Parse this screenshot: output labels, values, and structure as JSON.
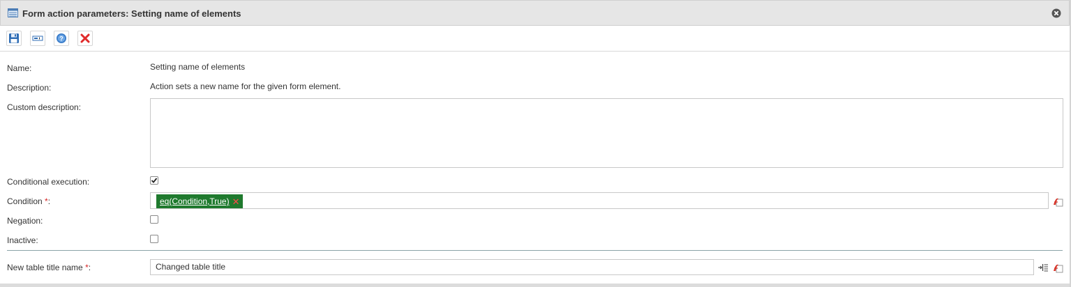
{
  "window": {
    "title": "Form action parameters: Setting name of elements",
    "title_icon": "form-table-icon",
    "close_icon": "close-circle-icon"
  },
  "toolbar": {
    "buttons": [
      {
        "name": "save-button",
        "icon": "floppy-disk-icon"
      },
      {
        "name": "text-field-button",
        "icon": "text-field-icon"
      },
      {
        "name": "help-button",
        "icon": "question-circle-icon"
      },
      {
        "name": "cancel-button",
        "icon": "red-x-icon"
      }
    ]
  },
  "form": {
    "name": {
      "label": "Name:",
      "value": "Setting name of elements"
    },
    "description": {
      "label": "Description:",
      "value": "Action sets a new name for the given form element."
    },
    "custom_description": {
      "label": "Custom description:",
      "value": ""
    },
    "conditional_execution": {
      "label": "Conditional execution:",
      "checked": true
    },
    "condition": {
      "label": "Condition",
      "required_mark": "*",
      "colon": ":",
      "token": "eq(Condition,True)",
      "token_remove": "✕"
    },
    "negation": {
      "label": "Negation:",
      "checked": false
    },
    "inactive": {
      "label": "Inactive:",
      "checked": false
    },
    "new_table_title": {
      "label": "New table title name",
      "required_mark": "*",
      "colon": ":",
      "value": "Changed table title"
    }
  },
  "colors": {
    "title_bg": "#e6e6e6",
    "token_bg": "#1f7a2e",
    "required": "#d62222",
    "divider": "#8aa3a8"
  }
}
